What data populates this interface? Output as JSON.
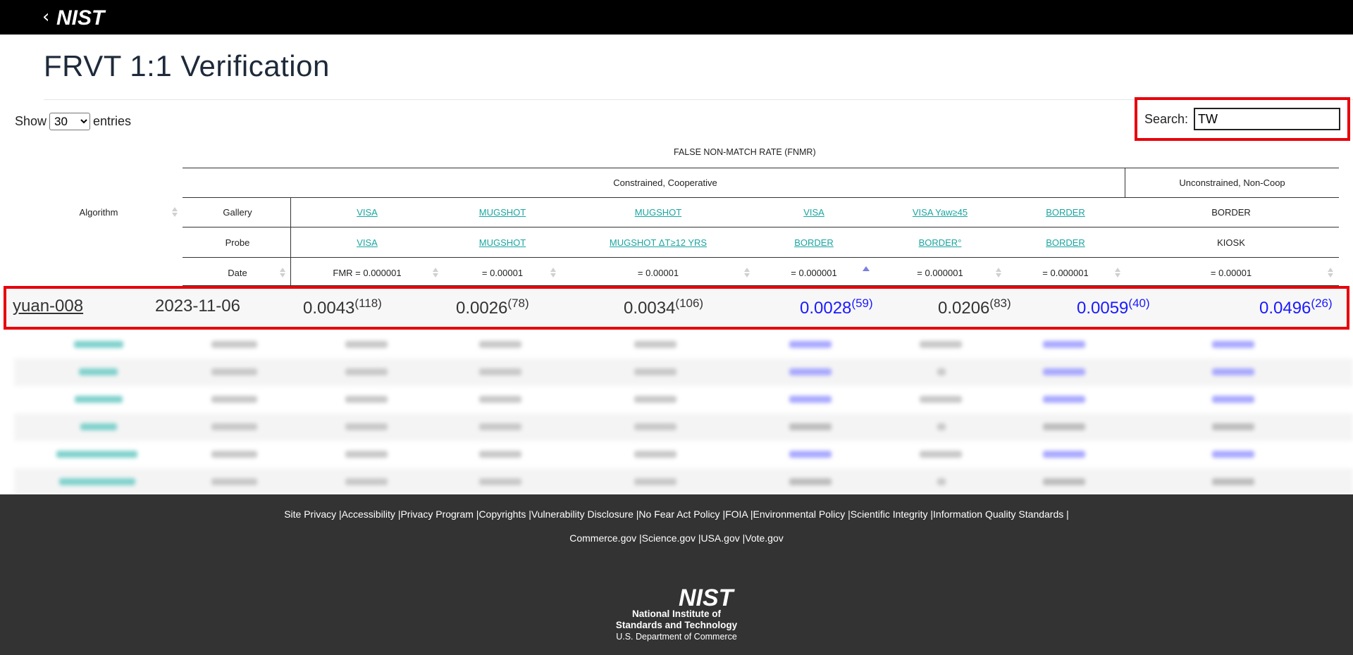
{
  "header": {
    "back_glyph": "‹",
    "logo_text": "NIST"
  },
  "page_title": "FRVT 1:1 Verification",
  "length_control": {
    "prefix": "Show",
    "selected": "30",
    "suffix": "entries"
  },
  "search": {
    "label": "Search:",
    "value": "TW"
  },
  "table_header": {
    "group_title": "FALSE NON-MATCH RATE (FNMR)",
    "group_constrained": "Constrained, Cooperative",
    "group_unconstrained": "Unconstrained, Non-Coop",
    "algorithm_label": "Algorithm",
    "gallery_label": "Gallery",
    "probe_label": "Probe",
    "date_label": "Date",
    "gallery": [
      "VISA",
      "MUGSHOT",
      "MUGSHOT",
      "VISA",
      "VISA Yaw≥45",
      "BORDER",
      "BORDER"
    ],
    "probe": [
      "VISA",
      "MUGSHOT",
      "MUGSHOT ΔT≥12 YRS",
      "BORDER",
      "BORDER°",
      "BORDER",
      "KIOSK"
    ],
    "fmr": [
      "FMR = 0.000001",
      "= 0.00001",
      "= 0.00001",
      "= 0.000001",
      "= 0.000001",
      "= 0.000001",
      "= 0.00001"
    ]
  },
  "highlighted_row": {
    "algorithm": "yuan-008",
    "date": "2023-11-06",
    "values": [
      {
        "v": "0.0043",
        "rank": "(118)"
      },
      {
        "v": "0.0026",
        "rank": "(78)"
      },
      {
        "v": "0.0034",
        "rank": "(106)"
      },
      {
        "v": "0.0028",
        "rank": "(59)"
      },
      {
        "v": "0.0206",
        "rank": "(83)"
      },
      {
        "v": "0.0059",
        "rank": "(40)"
      },
      {
        "v": "0.0496",
        "rank": "(26)"
      }
    ]
  },
  "footer": {
    "links_row1": [
      "Site Privacy",
      "Accessibility",
      "Privacy Program",
      "Copyrights",
      "Vulnerability Disclosure",
      "No Fear Act Policy",
      "FOIA",
      "Environmental Policy",
      "Scientific Integrity",
      "Information Quality Standards"
    ],
    "links_row2": [
      "Commerce.gov",
      "Science.gov",
      "USA.gov",
      "Vote.gov"
    ],
    "logo_text": "NIST",
    "institute_line1": "National Institute of",
    "institute_line2": "Standards and Technology",
    "department": "U.S. Department of Commerce"
  },
  "colors": {
    "link": "#1aa5a0",
    "highlight_border": "#e8000b",
    "blue_value": "#1a1aff",
    "footer_bg": "#333333"
  }
}
